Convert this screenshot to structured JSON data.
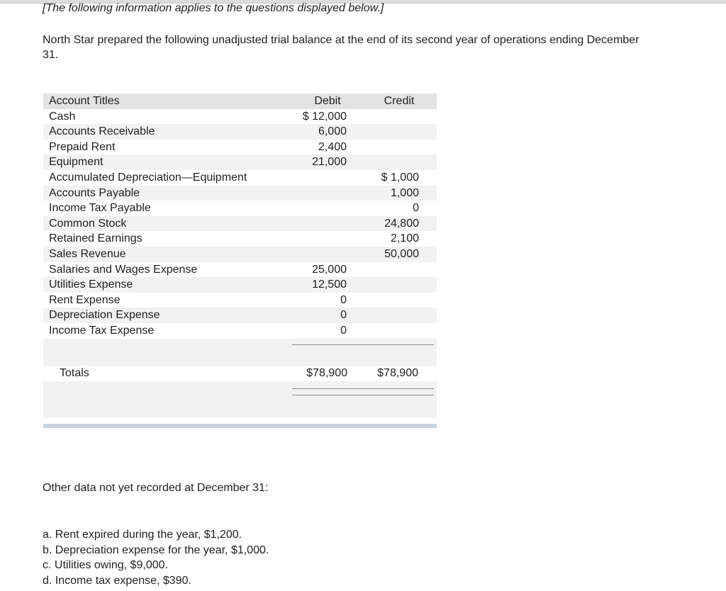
{
  "intro_note": "[The following information applies to the questions displayed below.]",
  "intro_text": "North Star prepared the following unadjusted trial balance at the end of its second year of operations ending December 31.",
  "trial_balance": {
    "headers": {
      "title": "Account Titles",
      "debit": "Debit",
      "credit": "Credit"
    },
    "rows": [
      {
        "title": "Cash",
        "debit": "$ 12,000",
        "credit": ""
      },
      {
        "title": "Accounts Receivable",
        "debit": "6,000",
        "credit": ""
      },
      {
        "title": "Prepaid Rent",
        "debit": "2,400",
        "credit": ""
      },
      {
        "title": "Equipment",
        "debit": "21,000",
        "credit": ""
      },
      {
        "title": "Accumulated Depreciation—Equipment",
        "debit": "",
        "credit": "$  1,000"
      },
      {
        "title": "Accounts Payable",
        "debit": "",
        "credit": "1,000"
      },
      {
        "title": "Income Tax Payable",
        "debit": "",
        "credit": "0"
      },
      {
        "title": "Common Stock",
        "debit": "",
        "credit": "24,800"
      },
      {
        "title": "Retained Earnings",
        "debit": "",
        "credit": "2,100"
      },
      {
        "title": "Sales Revenue",
        "debit": "",
        "credit": "50,000"
      },
      {
        "title": "Salaries and Wages Expense",
        "debit": "25,000",
        "credit": ""
      },
      {
        "title": "Utilities Expense",
        "debit": "12,500",
        "credit": ""
      },
      {
        "title": "Rent Expense",
        "debit": "0",
        "credit": ""
      },
      {
        "title": "Depreciation Expense",
        "debit": "0",
        "credit": ""
      },
      {
        "title": "Income Tax Expense",
        "debit": "0",
        "credit": ""
      }
    ],
    "totals": {
      "title": "Totals",
      "debit": "$78,900",
      "credit": "$78,900"
    }
  },
  "other_data": {
    "heading": "Other data not yet recorded at December 31:",
    "items": [
      "a.  Rent expired during the year, $1,200.",
      "b.  Depreciation expense for the year, $1,000.",
      "c.  Utilities owing, $9,000.",
      "d.  Income tax expense, $390."
    ]
  }
}
